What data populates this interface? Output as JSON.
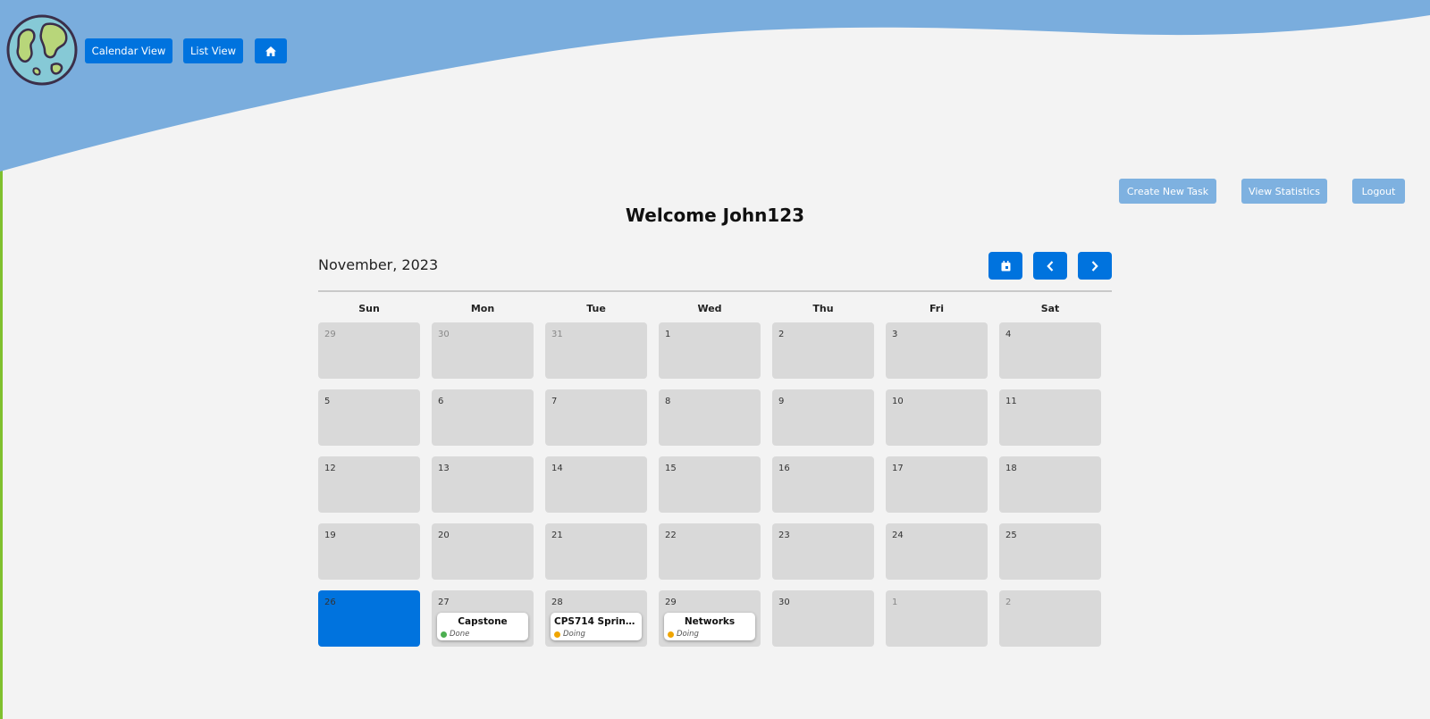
{
  "nav": {
    "calendar_view": "Calendar View",
    "list_view": "List View",
    "home_icon": "home-icon"
  },
  "actions": {
    "create_task": "Create New Task",
    "view_statistics": "View Statistics",
    "logout": "Logout"
  },
  "welcome": "Welcome John123",
  "calendar": {
    "month_label": "November, 2023",
    "controls": [
      "calendar-icon",
      "chevron-left-icon",
      "chevron-right-icon"
    ],
    "weekdays": [
      "Sun",
      "Mon",
      "Tue",
      "Wed",
      "Thu",
      "Fri",
      "Sat"
    ],
    "weeks": [
      [
        {
          "d": "29",
          "other": true
        },
        {
          "d": "30",
          "other": true
        },
        {
          "d": "31",
          "other": true
        },
        {
          "d": "1"
        },
        {
          "d": "2"
        },
        {
          "d": "3"
        },
        {
          "d": "4"
        }
      ],
      [
        {
          "d": "5"
        },
        {
          "d": "6"
        },
        {
          "d": "7"
        },
        {
          "d": "8"
        },
        {
          "d": "9"
        },
        {
          "d": "10"
        },
        {
          "d": "11"
        }
      ],
      [
        {
          "d": "12"
        },
        {
          "d": "13"
        },
        {
          "d": "14"
        },
        {
          "d": "15"
        },
        {
          "d": "16"
        },
        {
          "d": "17"
        },
        {
          "d": "18"
        }
      ],
      [
        {
          "d": "19"
        },
        {
          "d": "20"
        },
        {
          "d": "21"
        },
        {
          "d": "22"
        },
        {
          "d": "23"
        },
        {
          "d": "24"
        },
        {
          "d": "25"
        }
      ],
      [
        {
          "d": "26",
          "today": true
        },
        {
          "d": "27",
          "task": {
            "title": "Capstone",
            "status": "Done",
            "color": "#4caf50"
          }
        },
        {
          "d": "28",
          "task": {
            "title": "CPS714 Sprint 4 D...",
            "status": "Doing",
            "color": "#f0a500"
          }
        },
        {
          "d": "29",
          "task": {
            "title": "Networks",
            "status": "Doing",
            "color": "#f0a500"
          }
        },
        {
          "d": "30"
        },
        {
          "d": "1",
          "other": true
        },
        {
          "d": "2",
          "other": true
        }
      ]
    ]
  },
  "colors": {
    "primary": "#0073de",
    "action_light": "#7eb1e0",
    "header_wave": "#7aaddd",
    "cell": "#d9d9d9",
    "background": "#f3f3f3",
    "done": "#4caf50",
    "doing": "#f0a500"
  }
}
